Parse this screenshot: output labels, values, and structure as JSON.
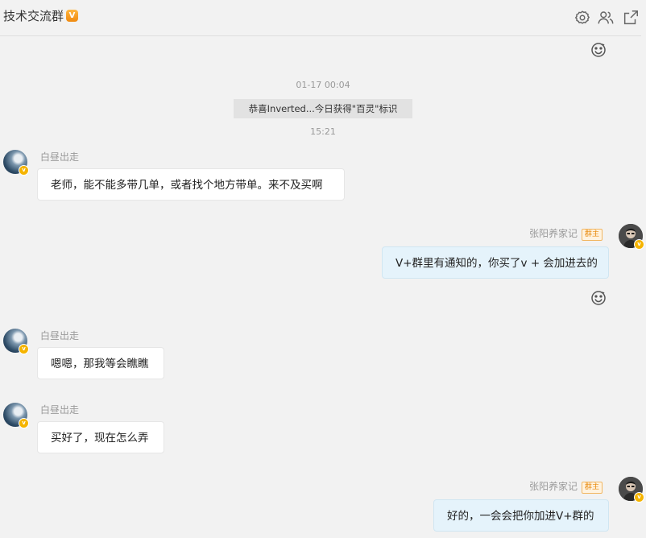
{
  "header": {
    "title": "技术交流群",
    "vip_badge": "V",
    "icons": [
      "gear-icon",
      "members-icon",
      "share-icon"
    ]
  },
  "messages": [
    {
      "kind": "time",
      "text": "01-17 00:04"
    },
    {
      "kind": "system",
      "text": "恭喜Inverted...今日获得\"百灵\"标识"
    },
    {
      "kind": "time",
      "text": "15:21"
    },
    {
      "kind": "message",
      "side": "left",
      "sender": "白昼出走",
      "text": "老师，能不能多带几单，或者找个地方带单。来不及买啊"
    },
    {
      "kind": "message",
      "side": "right",
      "sender": "张阳养家记",
      "role": "群主",
      "text": "V+群里有通知的，你买了v + 会加进去的"
    },
    {
      "kind": "message",
      "side": "left",
      "sender": "白昼出走",
      "text": "嗯嗯，那我等会瞧瞧"
    },
    {
      "kind": "message",
      "side": "left",
      "sender": "白昼出走",
      "text": "买好了，现在怎么弄"
    },
    {
      "kind": "message",
      "side": "right",
      "sender": "张阳养家记",
      "role": "群主",
      "text": "好的，一会会把你加进V+群的"
    }
  ],
  "colors": {
    "background": "#f2f2f2",
    "bubble_left": "#ffffff",
    "bubble_right": "#e5f3fb",
    "owner_tag": "#e8890c",
    "vip_badge": "#f5b400"
  }
}
